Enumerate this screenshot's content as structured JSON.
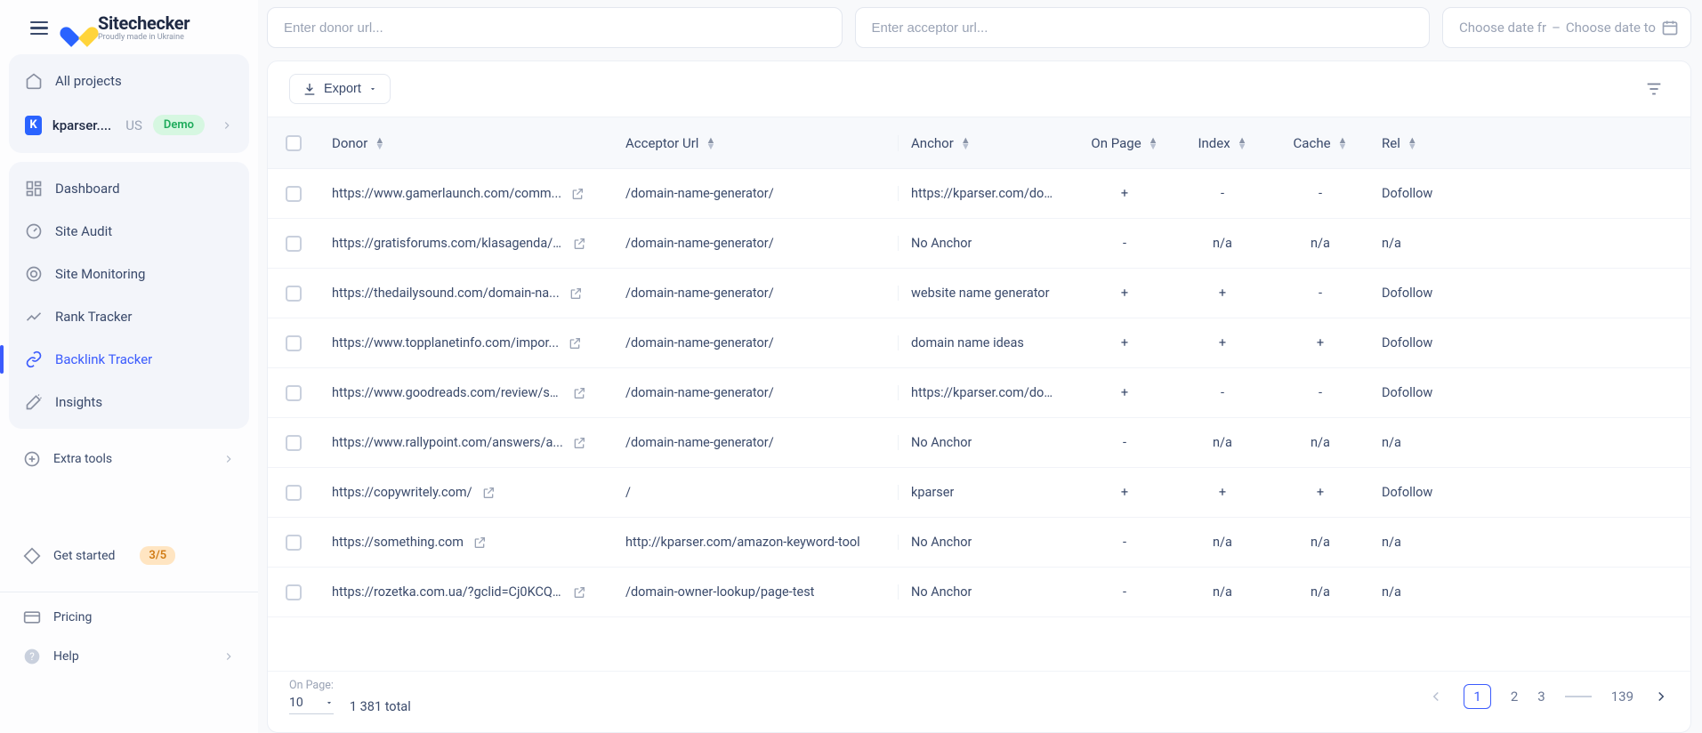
{
  "brand": {
    "name": "Sitechecker",
    "tagline": "Proudly made in Ukraine"
  },
  "sidebar": {
    "all_projects": "All projects",
    "project": {
      "initial": "K",
      "name": "kparser....",
      "region": "US",
      "demo": "Demo"
    },
    "items": [
      {
        "label": "Dashboard"
      },
      {
        "label": "Site Audit"
      },
      {
        "label": "Site Monitoring"
      },
      {
        "label": "Rank Tracker"
      },
      {
        "label": "Backlink Tracker"
      },
      {
        "label": "Insights"
      }
    ],
    "extra_tools": "Extra tools",
    "get_started": {
      "label": "Get started",
      "count": "3/5"
    },
    "pricing": "Pricing",
    "help": "Help"
  },
  "filters": {
    "donor_placeholder": "Enter donor url...",
    "acceptor_placeholder": "Enter acceptor url...",
    "date_from": "Choose date fr",
    "date_sep": "–",
    "date_to": "Choose date to"
  },
  "toolbar": {
    "export": "Export"
  },
  "columns": {
    "donor": "Donor",
    "acceptor": "Acceptor Url",
    "anchor": "Anchor",
    "onpage": "On Page",
    "index": "Index",
    "cache": "Cache",
    "rel": "Rel"
  },
  "rows": [
    {
      "donor": "https://www.gamerlaunch.com/comm...",
      "acceptor": "/domain-name-generator/",
      "anchor": "https://kparser.com/dom...",
      "onpage": "+",
      "index": "-",
      "cache": "-",
      "rel": "Dofollow"
    },
    {
      "donor": "https://gratisforums.com/klasagenda/v...",
      "acceptor": "/domain-name-generator/",
      "anchor": "No Anchor",
      "onpage": "-",
      "index": "n/a",
      "cache": "n/a",
      "rel": "n/a"
    },
    {
      "donor": "https://thedailysound.com/domain-na...",
      "acceptor": "/domain-name-generator/",
      "anchor": "website name generator",
      "onpage": "+",
      "index": "+",
      "cache": "-",
      "rel": "Dofollow"
    },
    {
      "donor": "https://www.topplanetinfo.com/impor...",
      "acceptor": "/domain-name-generator/",
      "anchor": "domain name ideas",
      "onpage": "+",
      "index": "+",
      "cache": "+",
      "rel": "Dofollow"
    },
    {
      "donor": "https://www.goodreads.com/review/sh...",
      "acceptor": "/domain-name-generator/",
      "anchor": "https://kparser.com/dom...",
      "onpage": "+",
      "index": "-",
      "cache": "-",
      "rel": "Dofollow"
    },
    {
      "donor": "https://www.rallypoint.com/answers/a...",
      "acceptor": "/domain-name-generator/",
      "anchor": "No Anchor",
      "onpage": "-",
      "index": "n/a",
      "cache": "n/a",
      "rel": "n/a"
    },
    {
      "donor": "https://copywritely.com/",
      "acceptor": "/",
      "anchor": "kparser",
      "onpage": "+",
      "index": "+",
      "cache": "+",
      "rel": "Dofollow"
    },
    {
      "donor": "https://something.com",
      "acceptor": "http://kparser.com/amazon-keyword-tool",
      "anchor": "No Anchor",
      "onpage": "-",
      "index": "n/a",
      "cache": "n/a",
      "rel": "n/a"
    },
    {
      "donor": "https://rozetka.com.ua/?gclid=Cj0KCQj...",
      "acceptor": "/domain-owner-lookup/page-test",
      "anchor": "No Anchor",
      "onpage": "-",
      "index": "n/a",
      "cache": "n/a",
      "rel": "n/a"
    }
  ],
  "footer": {
    "onpage_label": "On Page:",
    "page_size": "10",
    "total": "1 381 total",
    "pages": {
      "p1": "1",
      "p2": "2",
      "p3": "3",
      "last": "139"
    }
  }
}
